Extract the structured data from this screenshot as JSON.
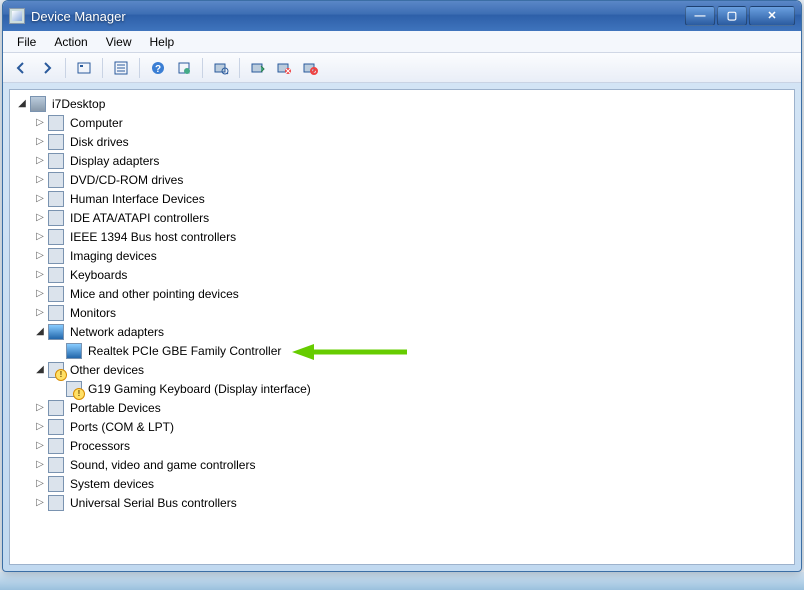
{
  "window": {
    "title": "Device Manager"
  },
  "menu": {
    "file": "File",
    "action": "Action",
    "view": "View",
    "help": "Help"
  },
  "toolbar_icons": [
    "back",
    "forward",
    "show-hidden",
    "properties",
    "help",
    "refresh",
    "scan",
    "update-driver",
    "uninstall",
    "disable"
  ],
  "tree": {
    "root": "i7Desktop",
    "categories": [
      {
        "id": "computer",
        "label": "Computer",
        "expanded": false
      },
      {
        "id": "disk",
        "label": "Disk drives",
        "expanded": false
      },
      {
        "id": "display",
        "label": "Display adapters",
        "expanded": false
      },
      {
        "id": "dvd",
        "label": "DVD/CD-ROM drives",
        "expanded": false
      },
      {
        "id": "hid",
        "label": "Human Interface Devices",
        "expanded": false
      },
      {
        "id": "ide",
        "label": "IDE ATA/ATAPI controllers",
        "expanded": false
      },
      {
        "id": "1394",
        "label": "IEEE 1394 Bus host controllers",
        "expanded": false
      },
      {
        "id": "imaging",
        "label": "Imaging devices",
        "expanded": false
      },
      {
        "id": "kbd",
        "label": "Keyboards",
        "expanded": false
      },
      {
        "id": "mice",
        "label": "Mice and other pointing devices",
        "expanded": false
      },
      {
        "id": "monitors",
        "label": "Monitors",
        "expanded": false
      },
      {
        "id": "network",
        "label": "Network adapters",
        "expanded": true,
        "children": [
          {
            "id": "realtek",
            "label": "Realtek PCIe GBE Family Controller",
            "highlighted": true
          }
        ]
      },
      {
        "id": "other",
        "label": "Other devices",
        "expanded": true,
        "warn": true,
        "children": [
          {
            "id": "g19",
            "label": "G19 Gaming Keyboard (Display interface)",
            "warn": true
          }
        ]
      },
      {
        "id": "portable",
        "label": "Portable Devices",
        "expanded": false
      },
      {
        "id": "ports",
        "label": "Ports (COM & LPT)",
        "expanded": false
      },
      {
        "id": "cpu",
        "label": "Processors",
        "expanded": false
      },
      {
        "id": "sound",
        "label": "Sound, video and game controllers",
        "expanded": false
      },
      {
        "id": "system",
        "label": "System devices",
        "expanded": false
      },
      {
        "id": "usb",
        "label": "Universal Serial Bus controllers",
        "expanded": false
      }
    ]
  },
  "annotation": {
    "target": "realtek",
    "color": "#66cc00"
  }
}
